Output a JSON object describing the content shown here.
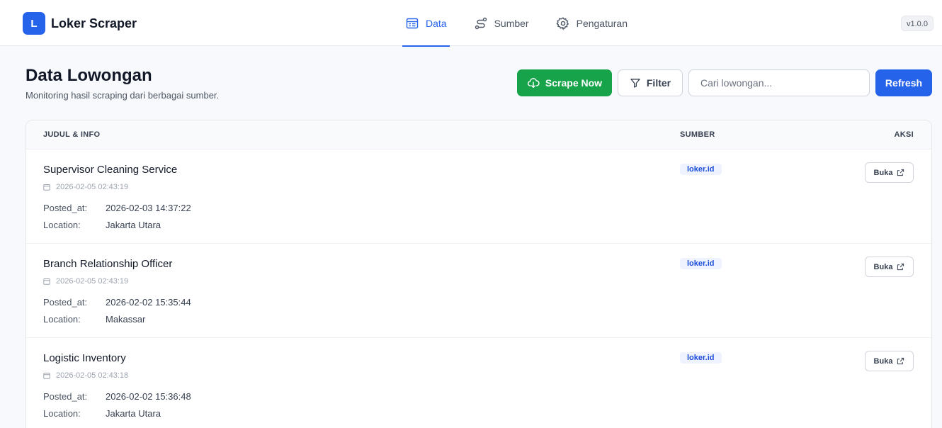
{
  "app": {
    "logo_letter": "L",
    "title": "Loker Scraper",
    "version": "v1.0.0"
  },
  "nav": {
    "tabs": [
      {
        "label": "Data",
        "icon": "table-icon",
        "active": true
      },
      {
        "label": "Sumber",
        "icon": "route-icon",
        "active": false
      },
      {
        "label": "Pengaturan",
        "icon": "gear-icon",
        "active": false
      }
    ]
  },
  "page": {
    "title": "Data Lowongan",
    "subtitle": "Monitoring hasil scraping dari berbagai sumber."
  },
  "toolbar": {
    "scrape_label": "Scrape Now",
    "filter_label": "Filter",
    "search_placeholder": "Cari lowongan...",
    "search_value": "",
    "refresh_label": "Refresh"
  },
  "table": {
    "headers": {
      "title": "JUDUL & INFO",
      "source": "SUMBER",
      "action": "AKSI"
    },
    "field_labels": {
      "posted_at": "Posted_at:",
      "location": "Location:"
    },
    "open_label": "Buka",
    "rows": [
      {
        "title": "Supervisor Cleaning Service",
        "scraped_at": "2026-02-05 02:43:19",
        "posted_at": "2026-02-03 14:37:22",
        "location": "Jakarta Utara",
        "source": "loker.id"
      },
      {
        "title": "Branch Relationship Officer",
        "scraped_at": "2026-02-05 02:43:19",
        "posted_at": "2026-02-02 15:35:44",
        "location": "Makassar",
        "source": "loker.id"
      },
      {
        "title": "Logistic Inventory",
        "scraped_at": "2026-02-05 02:43:18",
        "posted_at": "2026-02-02 15:36:48",
        "location": "Jakarta Utara",
        "source": "loker.id"
      }
    ]
  },
  "colors": {
    "primary": "#2563eb",
    "success": "#16a34a",
    "badge_bg": "#eef3ff",
    "badge_text": "#1d4ed8"
  }
}
